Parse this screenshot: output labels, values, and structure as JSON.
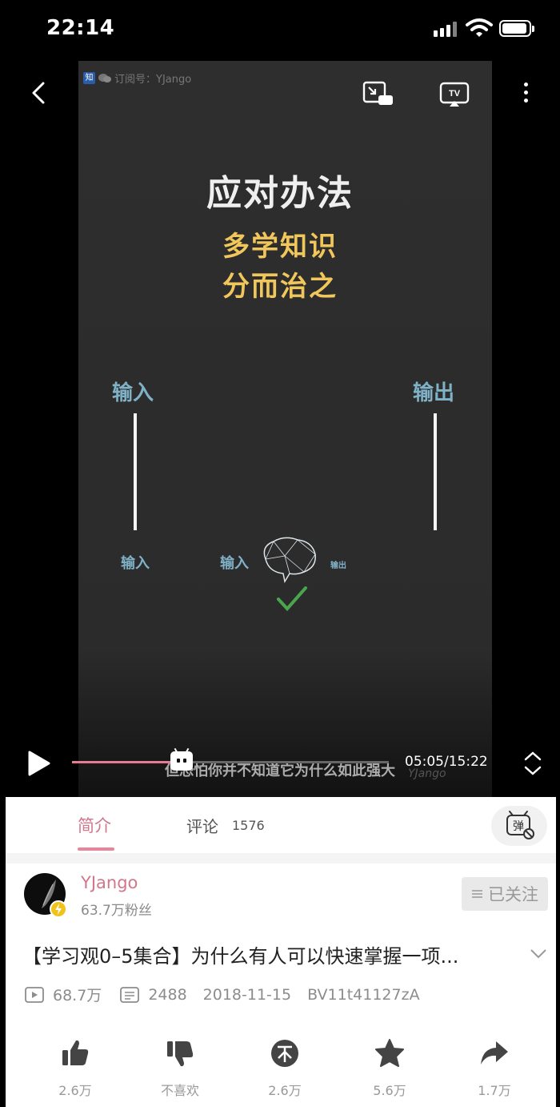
{
  "status_bar": {
    "time": "22:14"
  },
  "video": {
    "watermark_text": "订阅号：YJango",
    "headline": "应对办法",
    "sublines": [
      "多学知识",
      "分而治之"
    ],
    "input_label": "输入",
    "output_label": "输出",
    "input_small": "输入",
    "brain_input_label": "输入",
    "brain_output_label": "输出",
    "subtitle": "但恐怕你并不知道它为什么如此强大",
    "time_display": "05:05/15:22",
    "progress": 0.33,
    "channel_watermark": "YJango"
  },
  "tabs": {
    "intro_label": "简介",
    "comment_label": "评论",
    "comment_count": "1576",
    "danmaku_label": "弹"
  },
  "uploader": {
    "name": "YJango",
    "fans": "63.7万粉丝",
    "follow_label": "已关注"
  },
  "video_info": {
    "title": "【学习观0–5集合】为什么有人可以快速掌握一项...",
    "views": "68.7万",
    "danmaku_count": "2488",
    "date": "2018-11-15",
    "bvid": "BV11t41127zA"
  },
  "actions": [
    {
      "icon": "thumbs-up-icon",
      "label": "2.6万"
    },
    {
      "icon": "thumbs-down-icon",
      "label": "不喜欢"
    },
    {
      "icon": "coin-icon",
      "label": "2.6万"
    },
    {
      "icon": "star-icon",
      "label": "5.6万"
    },
    {
      "icon": "share-icon",
      "label": "1.7万"
    }
  ],
  "colors": {
    "accent": "#d0778d",
    "progress": "#e97a93",
    "headline_yellow": "#f1c75b",
    "label_blue": "#7fb1c7"
  }
}
